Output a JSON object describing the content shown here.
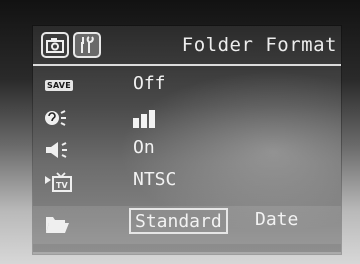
{
  "header": {
    "tabs": [
      {
        "icon": "camera-icon"
      },
      {
        "icon": "setup-tools-icon"
      }
    ],
    "title": "Folder Format"
  },
  "menu": {
    "rows": [
      {
        "icon": "save-icon",
        "icon_text": "SAVE",
        "value": "Off"
      },
      {
        "icon": "sound-volume-icon",
        "value_level": 3
      },
      {
        "icon": "speaker-icon",
        "value": "On"
      },
      {
        "icon": "tv-output-icon",
        "value": "NTSC"
      },
      {
        "icon": "folder-icon",
        "options": [
          "Standard",
          "Date"
        ],
        "selected": "Standard"
      }
    ]
  }
}
